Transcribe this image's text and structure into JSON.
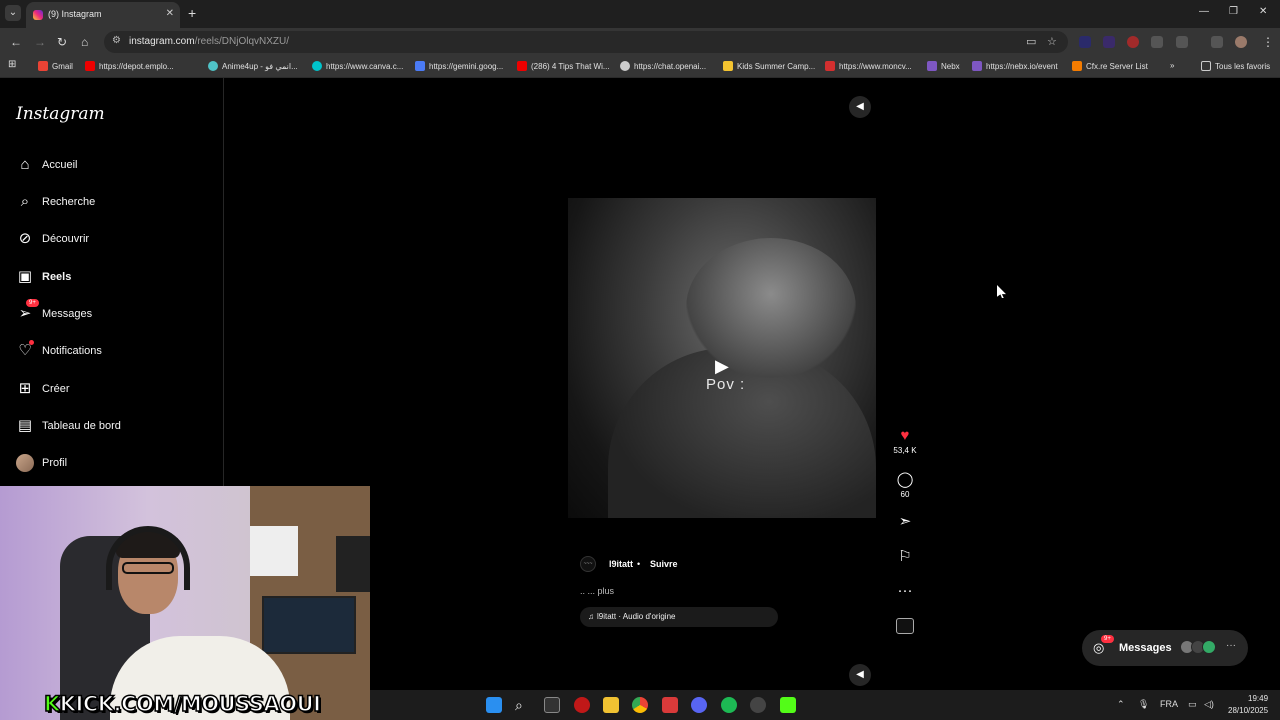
{
  "browser": {
    "tab_title": "(9) Instagram",
    "url_domain": "instagram.com",
    "url_path": "/reels/DNjOlqvNXZU/",
    "bookmarks": [
      "Gmail",
      "https://depot.emplo...",
      "Anime4up - انمي فو...",
      "https://www.canva.c...",
      "https://gemini.goog...",
      "(286) 4 Tips That Wi...",
      "https://chat.openai...",
      "Kids Summer Camp...",
      "https://www.moncv...",
      "Nebx",
      "https://nebx.io/event",
      "Cfx.re Server List"
    ],
    "all_bookmarks": "Tous les favoris"
  },
  "sidebar": {
    "logo": "Instagram",
    "items": [
      {
        "label": "Accueil",
        "icon": "home-icon"
      },
      {
        "label": "Recherche",
        "icon": "search-icon"
      },
      {
        "label": "Découvrir",
        "icon": "compass-icon"
      },
      {
        "label": "Reels",
        "icon": "reels-icon"
      },
      {
        "label": "Messages",
        "icon": "messenger-icon",
        "badge": "9+"
      },
      {
        "label": "Notifications",
        "icon": "heart-icon"
      },
      {
        "label": "Créer",
        "icon": "plus-square-icon"
      },
      {
        "label": "Tableau de bord",
        "icon": "dashboard-icon"
      },
      {
        "label": "Profil",
        "icon": "avatar"
      }
    ]
  },
  "reel": {
    "overlay_text": "Pov :",
    "likes": "53,4 K",
    "comments": "60",
    "username": "l9itatt",
    "separator": "•",
    "follow_label": "Suivre",
    "caption": ".. ... plus",
    "audio": "l9itatt · Audio d'origine",
    "avatar_text": "~~~"
  },
  "messages_widget": {
    "label": "Messages",
    "badge": "9+"
  },
  "webcam_overlay": {
    "k": "K",
    "rest": "KICK.COM/MOUSSAOUI"
  },
  "taskbar": {
    "language": "FRA",
    "time": "19:49",
    "date": "28/10/2025"
  },
  "colors": {
    "accent_like": "#ff3040",
    "kick_green": "#53fc18"
  }
}
